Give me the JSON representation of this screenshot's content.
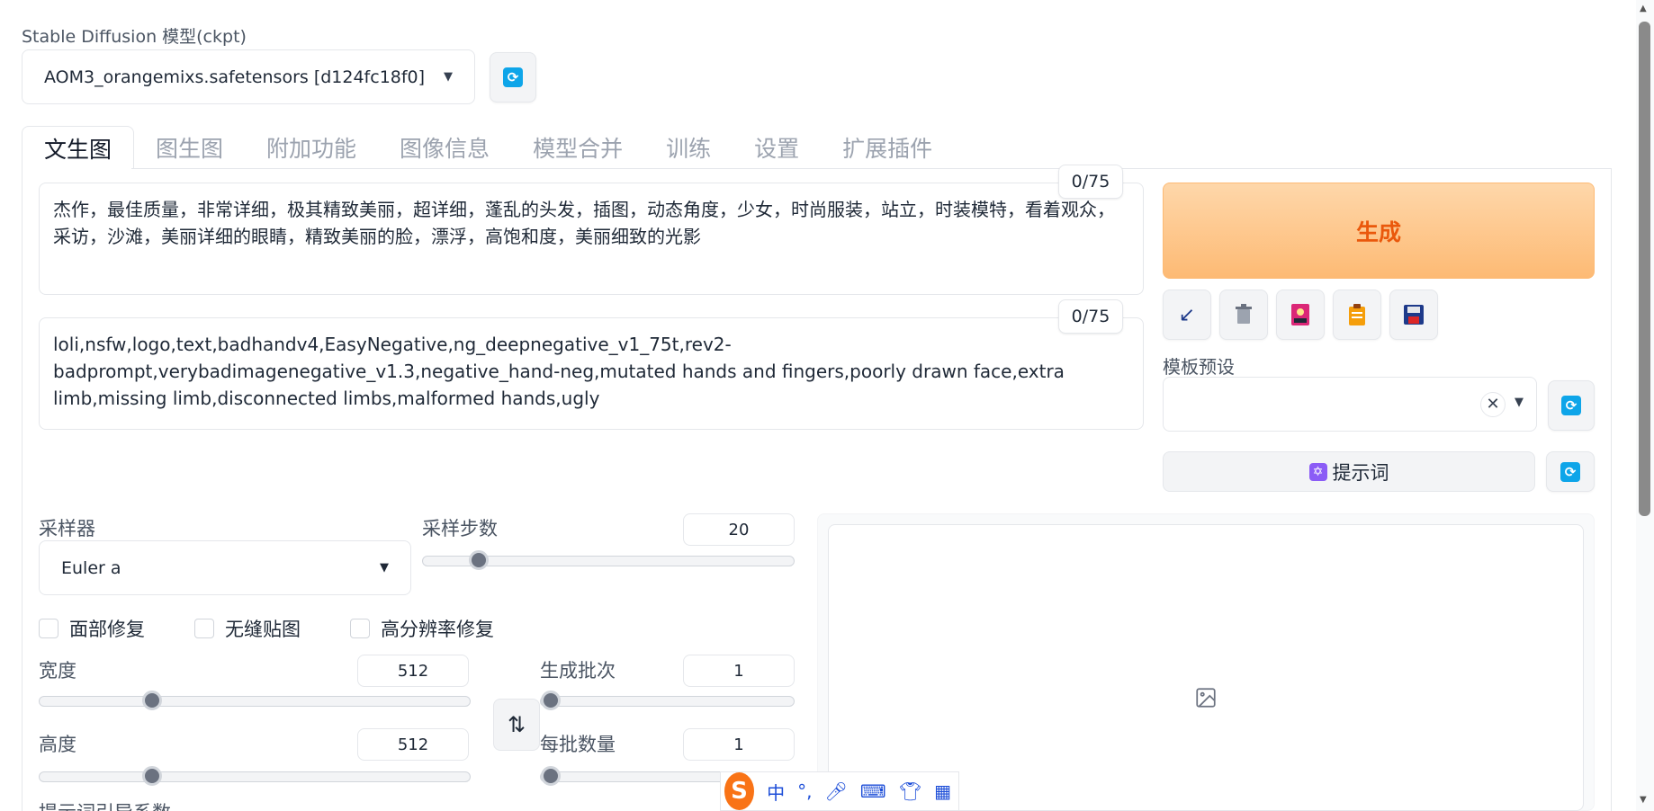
{
  "model": {
    "label": "Stable Diffusion 模型(ckpt)",
    "selected": "AOM3_orangemixs.safetensors [d124fc18f0]"
  },
  "tabs": [
    {
      "label": "文生图",
      "active": true
    },
    {
      "label": "图生图",
      "active": false
    },
    {
      "label": "附加功能",
      "active": false
    },
    {
      "label": "图像信息",
      "active": false
    },
    {
      "label": "模型合并",
      "active": false
    },
    {
      "label": "训练",
      "active": false
    },
    {
      "label": "设置",
      "active": false
    },
    {
      "label": "扩展插件",
      "active": false
    }
  ],
  "prompt": {
    "positive": "杰作，最佳质量，非常详细，极其精致美丽，超详细，蓬乱的头发，插图，动态角度，少女，时尚服装，站立，时装模特，看着观众，采访，沙滩，美丽详细的眼睛，精致美丽的脸，漂浮，高饱和度，美丽细致的光影",
    "positive_tokens": "0/75",
    "negative": "loli,nsfw,logo,text,badhandv4,EasyNegative,ng_deepnegative_v1_75t,rev2-badprompt,verybadimagenegative_v1.3,negative_hand-neg,mutated hands and fingers,poorly drawn face,extra limb,missing limb,disconnected limbs,malformed hands,ugly",
    "negative_tokens": "0/75"
  },
  "actions": {
    "generate_label": "生成",
    "tools": [
      "arrow-icon",
      "trash-icon",
      "image-icon",
      "clipboard-icon",
      "save-icon"
    ],
    "preset_label": "模板预设",
    "preset_value": "",
    "prompt_button_label": "提示词"
  },
  "sampler": {
    "label": "采样器",
    "value": "Euler a",
    "steps_label": "采样步数",
    "steps": "20",
    "steps_fraction": 0.13
  },
  "options": {
    "face_restore": "面部修复",
    "tiling": "无缝贴图",
    "hires_fix": "高分辨率修复"
  },
  "size": {
    "width_label": "宽度",
    "width": "512",
    "width_fraction": 0.25,
    "height_label": "高度",
    "height": "512",
    "height_fraction": 0.25
  },
  "batch": {
    "count_label": "生成批次",
    "count": "1",
    "size_label": "每批数量",
    "size": "1"
  },
  "cfg_label_partial": "提示词引导系数",
  "ime": {
    "logo": "S",
    "items": [
      "中",
      "°,",
      "mic-icon",
      "keyboard-icon",
      "shirt-icon",
      "grid-icon"
    ],
    "lang": "中",
    "punct": "°,"
  },
  "colors": {
    "accent": "#ea580c",
    "generate_bg": "#fdba74",
    "refresh": "#0ea5e9"
  }
}
